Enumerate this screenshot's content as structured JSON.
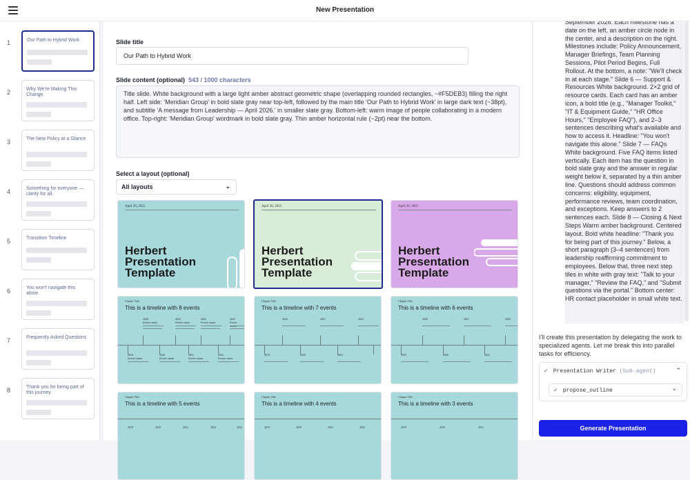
{
  "header": {
    "title": "New Presentation"
  },
  "slides": [
    {
      "num": "1",
      "title": "Our Path to Hybrid Work"
    },
    {
      "num": "2",
      "title": "Why We're Making This Change"
    },
    {
      "num": "3",
      "title": "The New Policy at a Glance"
    },
    {
      "num": "4",
      "title": "Something for everyone — clarity for all."
    },
    {
      "num": "5",
      "title": "Transition Timeline"
    },
    {
      "num": "6",
      "title": "You won't navigate this alone."
    },
    {
      "num": "7",
      "title": "Frequently Asked Questions"
    },
    {
      "num": "8",
      "title": "Thank you for being part of this journey."
    }
  ],
  "form": {
    "title_label": "Slide title",
    "title_value": "Our Path to Hybrid Work",
    "content_label": "Slide content (optional)",
    "char_count": "543 / 1000 characters",
    "content_value": "Title slide. White background with a large light amber abstract geometric shape (overlapping rounded rectangles, ~#F5DEB3) filling the right half. Left side: 'Meridian Group' in bold slate gray near top-left, followed by the main title 'Our Path to Hybrid Work' in large dark text (~38pt), and subtitle 'A message from Leadership — April 2026.' in smaller slate gray. Bottom-left: warm image of people collaborating in a modern office. Top-right: 'Meridian Group' wordmark in bold slate gray. Thin amber horizontal rule (~2pt) near the bottom.",
    "layout_label": "Select a layout (optional)",
    "layout_select": "All layouts"
  },
  "layouts": {
    "title_cards": [
      {
        "date": "April 30, 2025",
        "title": "Herbert Presentation Template",
        "bg": "#a6d8dc"
      },
      {
        "date": "April 30, 2025",
        "title": "Herbert Presentation Template",
        "bg": "#d8ecd8"
      },
      {
        "date": "April 30, 2025",
        "title": "Herbert Presentation Template",
        "bg": "#d9a8e8"
      }
    ],
    "timeline_cards": [
      {
        "chapter": "Chapter Title",
        "title": "This is a timeline with 8 events"
      },
      {
        "chapter": "Chapter Title",
        "title": "This is a timeline with 7 events"
      },
      {
        "chapter": "Chapter Title",
        "title": "This is a timeline with 6 events"
      },
      {
        "chapter": "Chapter Title",
        "title": "This is a timeline with 5 events"
      },
      {
        "chapter": "Chapter Title",
        "title": "This is a timeline with 4 events"
      },
      {
        "chapter": "Chapter Title",
        "title": "This is a timeline with 3 events"
      }
    ],
    "event_name": "Event name",
    "years_top": [
      "2020",
      "2021",
      "2022",
      "2023"
    ],
    "years_bottom": [
      "2019",
      "2020",
      "2021",
      "2022"
    ],
    "years_partial": [
      "2019",
      "2020",
      "2021",
      "2022",
      "2023"
    ]
  },
  "chat": {
    "text": "September 2026. Each milestone has a date on the left, an amber circle node in the center, and a description on the right. Milestones include: Policy Announcement, Manager Briefings, Team Planning Sessions, Pilot Period Begins, Full Rollout. At the bottom, a note: \"We'll check in at each stage.\" Slide 6 — Support & Resources White background. 2×2 grid of resource cards. Each card has an amber icon, a bold title (e.g., \"Manager Toolkit,\" \"IT & Equipment Guide,\" \"HR Office Hours,\" \"Employee FAQ\"), and 2–3 sentences describing what's available and how to access it. Headline: \"You won't navigate this alone.\" Slide 7 — FAQs White background. Five FAQ items listed vertically. Each item has the question in bold slate gray and the answer in regular weight below it, separated by a thin amber line. Questions should address common concerns: eligibility, equipment, performance reviews, team coordination, and exceptions. Keep answers to 2 sentences each. Slide 8 — Closing & Next Steps Warm amber background. Centered layout. Bold white headline: \"Thank you for being part of this journey.\" Below, a short paragraph (3–4 sentences) from leadership reaffirming commitment to employees. Below that, three next step tiles in white with gray text: \"Talk to your manager,\" \"Review the FAQ,\" and \"Submit questions via the portal.\" Bottom center: HR contact placeholder in small white text.",
    "assistant": "I'll create this presentation by delegating the work to specialized agents. Let me break this into parallel tasks for efficiency.",
    "agent_name": "Presentation Writer",
    "agent_tag": "(Sub-agent)",
    "tool_name": "propose_outline",
    "generate_label": "Generate Presentation"
  }
}
